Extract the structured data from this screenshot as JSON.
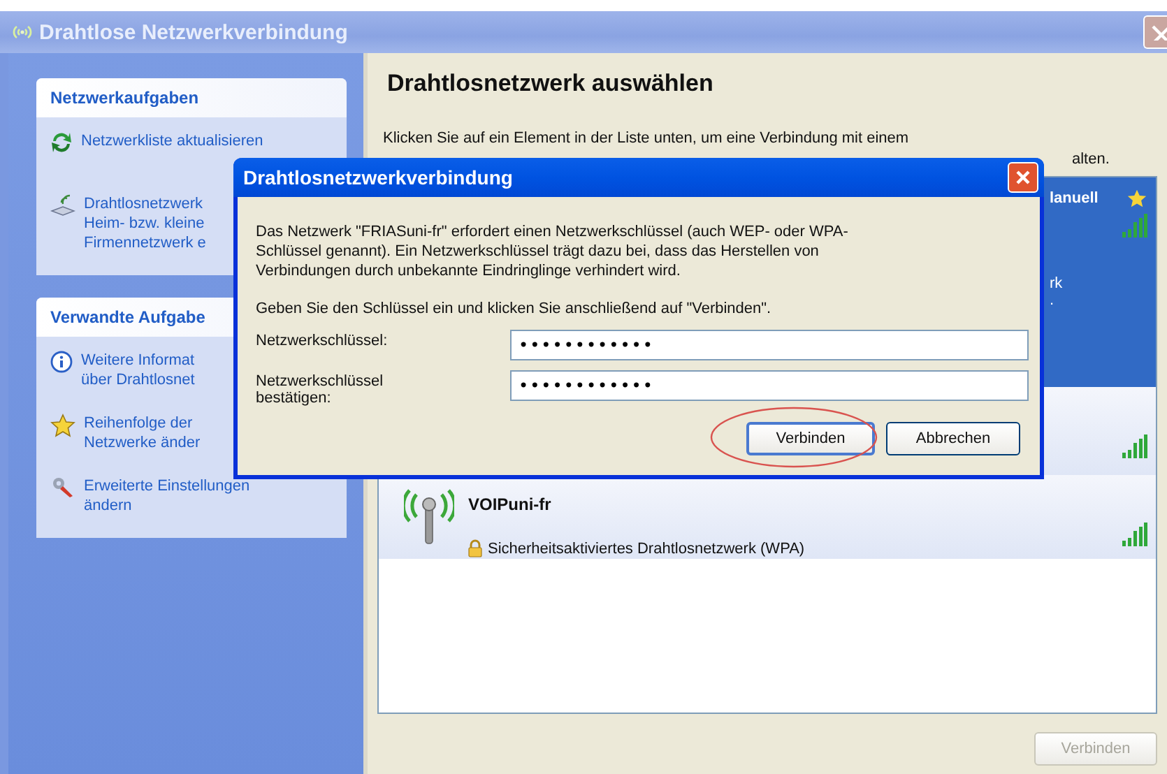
{
  "window": {
    "title": "Drahtlose Netzwerkverbindung"
  },
  "sidebar": {
    "sections": [
      {
        "title": "Netzwerkaufgaben",
        "items": [
          {
            "kind": "refresh",
            "lines": [
              "Netzwerkliste aktualisieren"
            ]
          },
          {
            "kind": "setup",
            "lines": [
              "Drahtlosnetzwerk",
              "Heim- bzw. kleine",
              "Firmennetzwerk e"
            ]
          }
        ]
      },
      {
        "title": "Verwandte Aufgabe",
        "items": [
          {
            "kind": "info",
            "lines": [
              "Weitere Informat",
              "über Drahtlosnet"
            ]
          },
          {
            "kind": "star",
            "lines": [
              "Reihenfolge der",
              "Netzwerke änder"
            ]
          },
          {
            "kind": "settings",
            "lines": [
              "Erweiterte Einstellungen",
              "ändern"
            ]
          }
        ]
      }
    ]
  },
  "main": {
    "heading": "Drahtlosnetzwerk auswählen",
    "intro": "Klicken Sie auf ein Element in der Liste unten, um eine Verbindung mit einem",
    "intro_fragment": "alten.",
    "networks": [
      {
        "selected": true,
        "name": "lanuell",
        "preferred": true,
        "status": "rk",
        "detail": "."
      },
      {
        "selected": false
      },
      {
        "selected": false,
        "name": "VOIPuni-fr",
        "security": "Sicherheitsaktiviertes Drahtlosnetzwerk (WPA)"
      }
    ],
    "connect_button": {
      "label": "Verbinden",
      "disabled": true
    }
  },
  "dialog": {
    "title": "Drahtlosnetzwerkverbindung",
    "message": "Das Netzwerk \"FRIASuni-fr\" erfordert einen Netzwerkschlüssel (auch WEP- oder WPA-Schlüssel genannt). Ein Netzwerkschlüssel trägt dazu bei, dass das Herstellen von Verbindungen durch unbekannte Eindringlinge verhindert wird.",
    "instruction": "Geben Sie den Schlüssel ein und klicken Sie anschließend auf \"Verbinden\".",
    "fields": [
      {
        "label": "Netzwerkschlüssel:",
        "value": "••••••••••••"
      },
      {
        "label": "Netzwerkschlüssel bestätigen:",
        "value": "••••••••••••"
      }
    ],
    "buttons": [
      {
        "label": "Verbinden",
        "default": true,
        "highlighted": true
      },
      {
        "label": "Abbrechen",
        "default": false,
        "highlighted": false
      }
    ]
  }
}
